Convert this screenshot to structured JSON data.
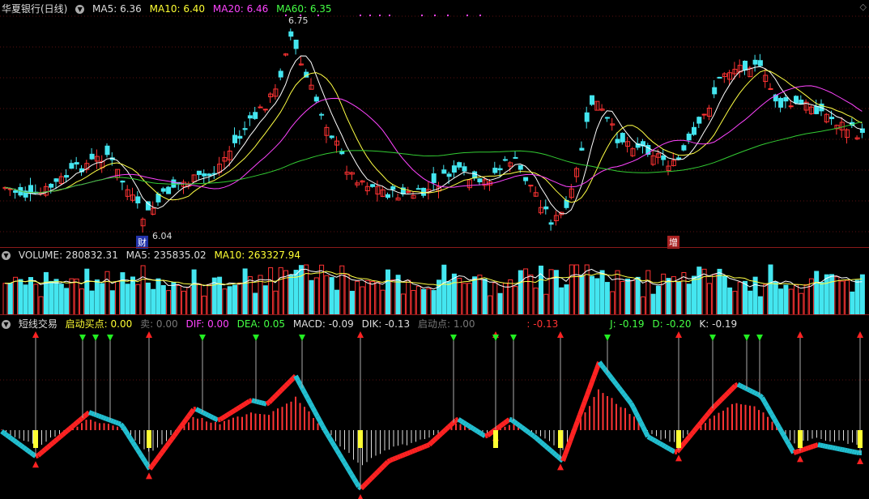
{
  "price_pane": {
    "title": "华夏银行(日线)",
    "ma5_label": "MA5: 6.36",
    "ma10_label": "MA10: 6.40",
    "ma20_label": "MA20: 6.46",
    "ma60_label": "MA60: 6.35",
    "high_label": "6.75",
    "low_label": "6.04",
    "badge_cai": "财",
    "badge_zeng": "增",
    "colors": {
      "up": "#ff3333",
      "down": "#44e6f0",
      "ma5": "#ffffff",
      "ma10": "#ffff44",
      "ma20": "#ff44ff",
      "ma60": "#33cc33"
    }
  },
  "volume_pane": {
    "volume_label": "VOLUME: 280832.31",
    "ma5_label": "MA5: 235835.02",
    "ma10_label": "MA10: 263327.94"
  },
  "indicator_pane": {
    "title": "短线交易",
    "buy_label": "启动买点: 0.00",
    "sell_label": "卖: 0.00",
    "dif_label": "DIF: 0.00",
    "dea_label": "DEA: 0.05",
    "macd_label": "MACD: -0.09",
    "dik_label": "DIK: -0.13",
    "start_label": "启动点: 1.00",
    "extra_label": ": -0.13",
    "j_label": "J: -0.19",
    "d_label": "D: -0.20",
    "k_label": "K: -0.19"
  },
  "icons": {
    "collapse": "chevron-down-icon",
    "corner": "diamond-icon"
  }
}
